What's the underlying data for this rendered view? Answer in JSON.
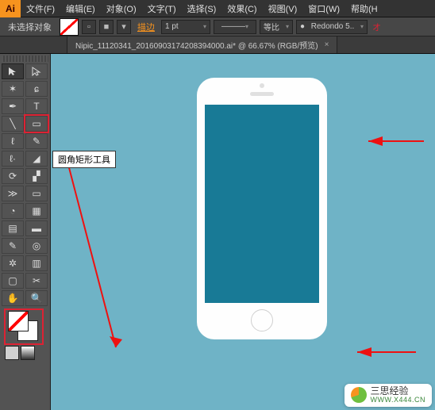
{
  "app": {
    "icon_text": "Ai"
  },
  "menu": [
    "文件(F)",
    "编辑(E)",
    "对象(O)",
    "文字(T)",
    "选择(S)",
    "效果(C)",
    "视图(V)",
    "窗口(W)",
    "帮助(H"
  ],
  "control": {
    "no_selection": "未选择对象",
    "stroke_label": "描边",
    "stroke_weight": "1 pt",
    "scale_label": "等比",
    "profile": "Redondo 5..",
    "cut_char": "オ"
  },
  "doc": {
    "title": "Nipic_11120341_20160903174208394000.ai* @ 66.67% (RGB/预览)",
    "close": "×"
  },
  "tooltip": "圆角矩形工具",
  "watermark": {
    "title": "三思经验",
    "url": "WWW.X444.CN"
  }
}
